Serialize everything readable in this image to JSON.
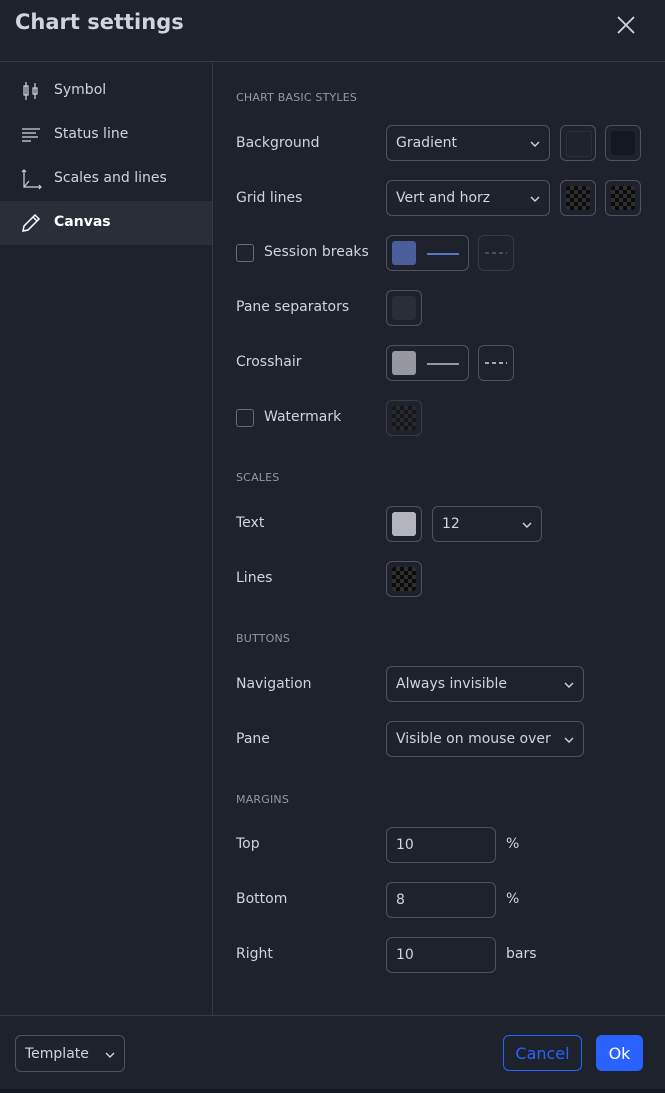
{
  "header": {
    "title": "Chart settings"
  },
  "sidebar": {
    "items": [
      {
        "label": "Symbol",
        "icon": "candlestick-icon"
      },
      {
        "label": "Status line",
        "icon": "status-line-icon"
      },
      {
        "label": "Scales and lines",
        "icon": "scales-icon"
      },
      {
        "label": "Canvas",
        "icon": "pencil-icon",
        "active": true
      }
    ]
  },
  "sections": {
    "chart_basic_styles": {
      "title": "CHART BASIC STYLES",
      "background": {
        "label": "Background",
        "value": "Gradient",
        "colors": [
          "#1e222d",
          "#131722"
        ]
      },
      "grid_lines": {
        "label": "Grid lines",
        "value": "Vert and horz"
      },
      "session_breaks": {
        "label": "Session breaks",
        "checked": false,
        "color": "#4a5e9b"
      },
      "pane_separators": {
        "label": "Pane separators",
        "color": "#2a2e39"
      },
      "crosshair": {
        "label": "Crosshair",
        "color": "#9598a1"
      },
      "watermark": {
        "label": "Watermark",
        "checked": false
      }
    },
    "scales": {
      "title": "SCALES",
      "text": {
        "label": "Text",
        "color": "#b2b5be",
        "size": "12"
      },
      "lines": {
        "label": "Lines"
      }
    },
    "buttons": {
      "title": "BUTTONS",
      "navigation": {
        "label": "Navigation",
        "value": "Always invisible"
      },
      "pane": {
        "label": "Pane",
        "value": "Visible on mouse over"
      }
    },
    "margins": {
      "title": "MARGINS",
      "top": {
        "label": "Top",
        "value": "10",
        "unit": "%"
      },
      "bottom": {
        "label": "Bottom",
        "value": "8",
        "unit": "%"
      },
      "right": {
        "label": "Right",
        "value": "10",
        "unit": "bars"
      }
    }
  },
  "footer": {
    "template_label": "Template",
    "cancel_label": "Cancel",
    "ok_label": "Ok"
  },
  "colors": {
    "accent": "#2962ff",
    "panel": "#1e222d",
    "border": "#50535e"
  }
}
